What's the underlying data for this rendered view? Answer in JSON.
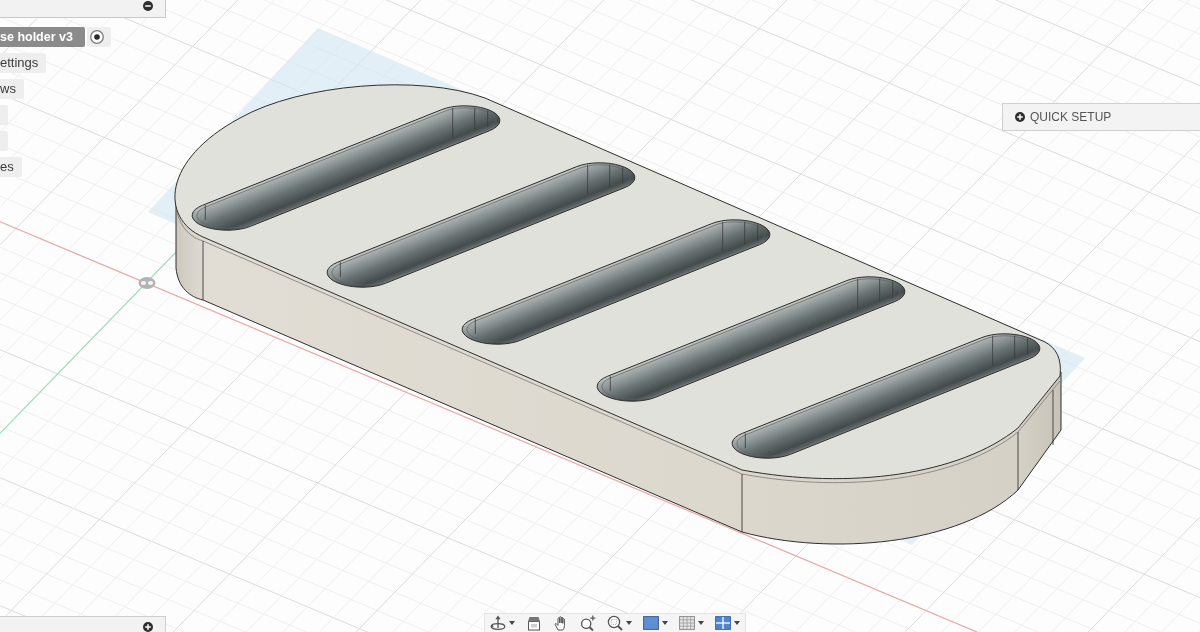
{
  "browser": {
    "expanded": true,
    "items": [
      {
        "label": "se holder v3",
        "selected": true
      },
      {
        "label": "ettings",
        "selected": false
      },
      {
        "label": "ws",
        "selected": false
      },
      {
        "selected": false
      },
      {
        "selected": false
      },
      {
        "label": "es",
        "selected": false
      }
    ],
    "root_radio": {
      "checked": true
    }
  },
  "quick_setup": {
    "label": "QUICK SETUP",
    "expanded": false
  },
  "bottom_panel": {
    "expanded": false
  },
  "navigation_bar": {
    "tools": [
      {
        "kind": "orbit",
        "has_menu": true
      },
      {
        "kind": "look_at",
        "has_menu": false
      },
      {
        "kind": "pan",
        "has_menu": false
      },
      {
        "kind": "zoom",
        "has_menu": false
      },
      {
        "kind": "fit",
        "has_menu": true
      },
      {
        "kind": "display",
        "has_menu": true
      },
      {
        "kind": "grid",
        "has_menu": true
      },
      {
        "kind": "viewports",
        "has_menu": true
      }
    ]
  }
}
